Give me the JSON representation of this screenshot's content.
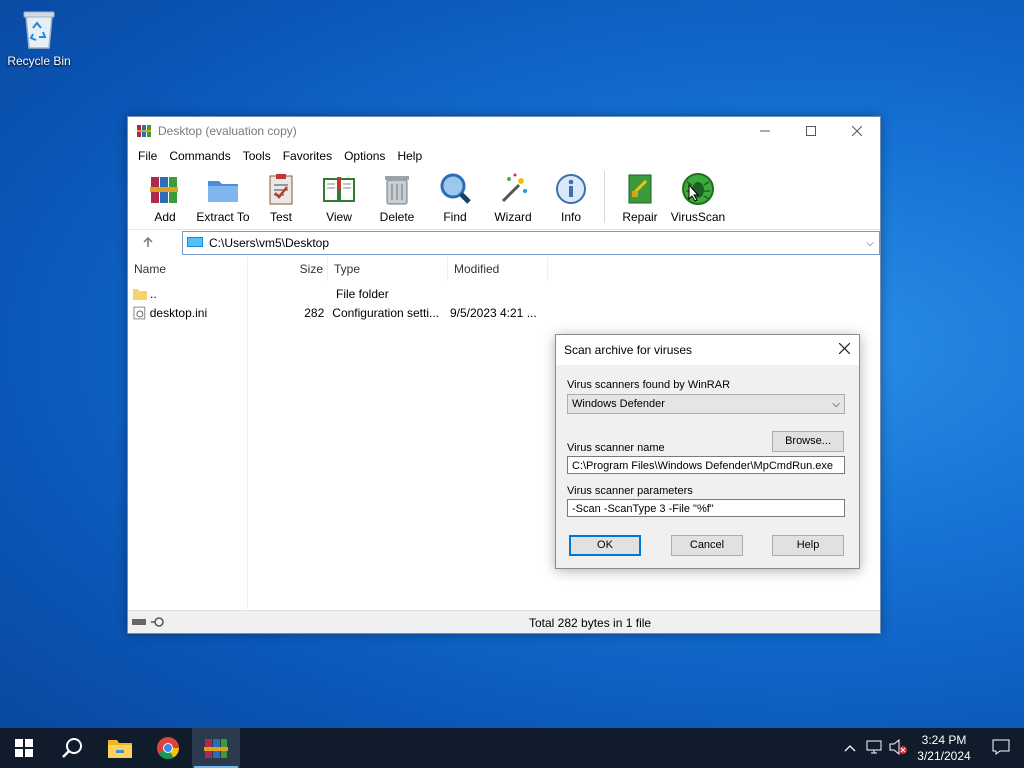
{
  "desktop": {
    "recycle_bin_label": "Recycle Bin"
  },
  "window": {
    "title": "Desktop (evaluation copy)",
    "menu": [
      "File",
      "Commands",
      "Tools",
      "Favorites",
      "Options",
      "Help"
    ],
    "toolbar": [
      "Add",
      "Extract To",
      "Test",
      "View",
      "Delete",
      "Find",
      "Wizard",
      "Info",
      "Repair",
      "VirusScan"
    ],
    "address": "C:\\Users\\vm5\\Desktop",
    "columns": {
      "name": "Name",
      "size": "Size",
      "type": "Type",
      "modified": "Modified"
    },
    "files": [
      {
        "name": "..",
        "size": "",
        "type": "File folder",
        "modified": ""
      },
      {
        "name": "desktop.ini",
        "size": "282",
        "type": "Configuration setti...",
        "modified": "9/5/2023 4:21 ..."
      }
    ],
    "status": "Total 282 bytes in 1 file"
  },
  "dialog": {
    "title": "Scan archive for viruses",
    "scanners_label": "Virus scanners found by WinRAR",
    "scanner_selected": "Windows Defender",
    "browse_label": "Browse...",
    "name_label": "Virus scanner name",
    "name_value": "C:\\Program Files\\Windows Defender\\MpCmdRun.exe",
    "params_label": "Virus scanner parameters",
    "params_value": "-Scan -ScanType 3 -File \"%f\"",
    "ok_label": "OK",
    "cancel_label": "Cancel",
    "help_label": "Help"
  },
  "taskbar": {
    "time": "3:24 PM",
    "date": "3/21/2024"
  },
  "colors": {
    "accent": "#0078d7",
    "taskbar": "#101b2b"
  }
}
